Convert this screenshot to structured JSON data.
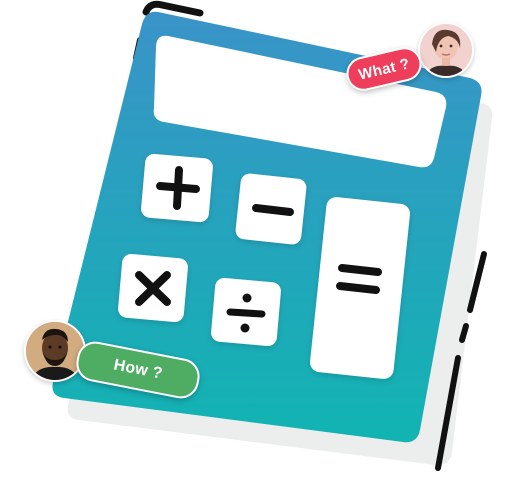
{
  "bubbles": {
    "what": "What ?",
    "how": "How ?"
  },
  "calculator": {
    "buttons": [
      "+",
      "−",
      "×",
      "÷",
      "="
    ],
    "body_gradient": [
      "#3a93c8",
      "#14b3b3"
    ],
    "accent_black": "#111111"
  },
  "colors": {
    "what_bubble": "#ef3e5b",
    "how_bubble": "#4fad63"
  },
  "icons": [
    "plus-icon",
    "minus-icon",
    "multiply-icon",
    "divide-icon",
    "equals-icon"
  ]
}
